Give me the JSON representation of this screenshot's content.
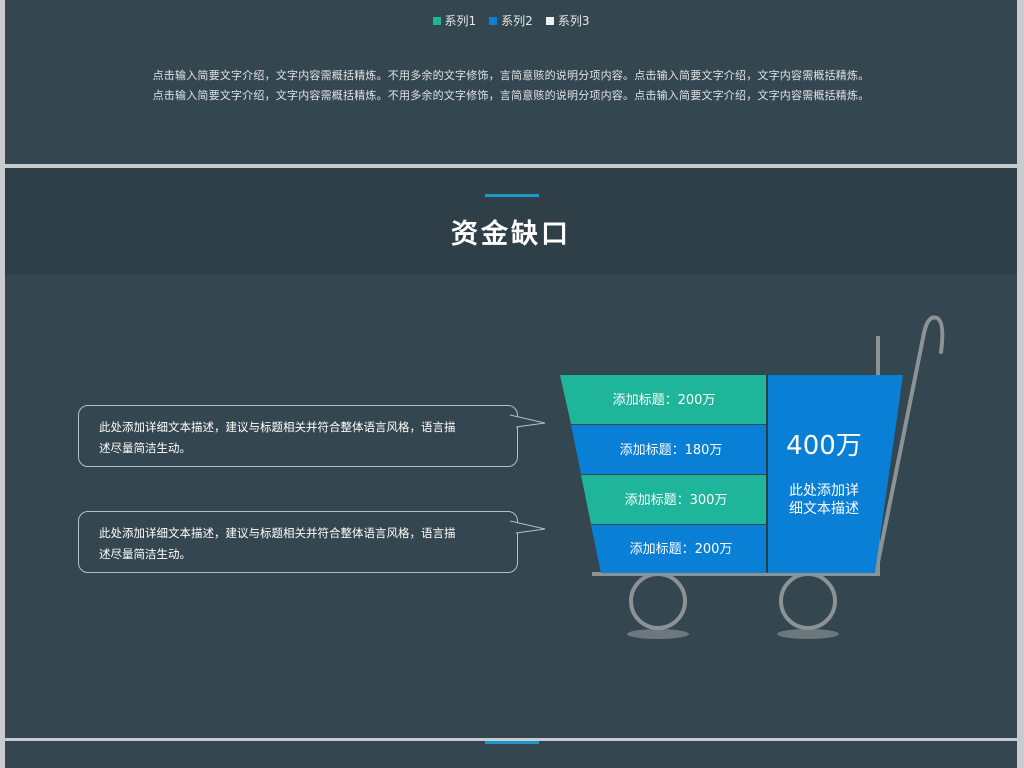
{
  "legend": {
    "items": [
      {
        "label": "系列1",
        "color": "#1fb59b"
      },
      {
        "label": "系列2",
        "color": "#0a7fd6"
      },
      {
        "label": "系列3",
        "color": "#f0f0f0"
      }
    ]
  },
  "intro": {
    "line1": "点击输入简要文字介绍，文字内容需概括精炼。不用多余的文字修饰，言简意赅的说明分项内容。点击输入简要文字介绍，文字内容需概括精炼。",
    "line2": "点击输入简要文字介绍，文字内容需概括精炼。不用多余的文字修饰，言简意赅的说明分项内容。点击输入简要文字介绍，文字内容需概括精炼。"
  },
  "section": {
    "title": "资金缺口"
  },
  "bubbles": [
    {
      "line1": "此处添加详细文本描述，建议与标题相关并符合整体语言风格，语言描",
      "line2": "述尽量简洁生动。"
    },
    {
      "line1": "此处添加详细文本描述，建议与标题相关并符合整体语言风格，语言描",
      "line2": "述尽量简洁生动。"
    }
  ],
  "cart": {
    "rows": [
      {
        "label": "添加标题：200万",
        "color": "#1fb59b"
      },
      {
        "label": "添加标题：180万",
        "color": "#0a7fd6"
      },
      {
        "label": "添加标题：300万",
        "color": "#1fb59b"
      },
      {
        "label": "添加标题：200万",
        "color": "#0a7fd6"
      }
    ],
    "total": "400万",
    "total_desc_line1": "此处添加详",
    "total_desc_line2": "细文本描述",
    "total_color": "#0a7fd6",
    "frame_color": "#8c9397"
  }
}
